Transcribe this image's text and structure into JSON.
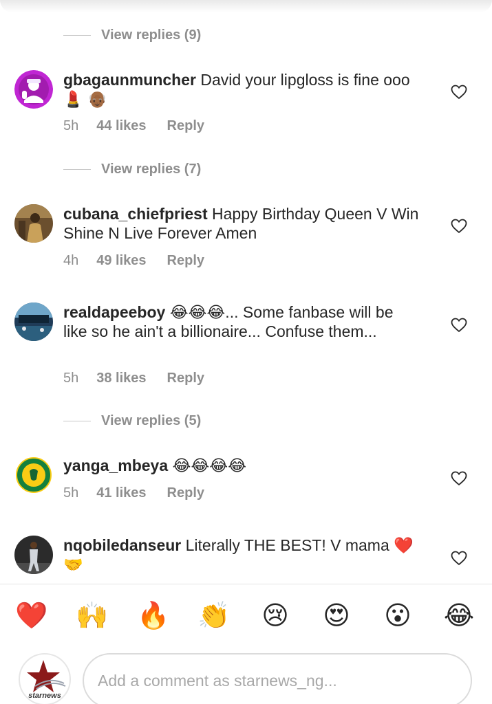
{
  "reply_toggles": [
    {
      "label": "View replies (9)"
    },
    {
      "label": "View replies (7)"
    },
    {
      "label": "View replies (5)"
    }
  ],
  "comments": [
    {
      "username": "gbagaunmuncher",
      "text": "David your lipgloss is fine ooo 💄 👴🏾",
      "time": "5h",
      "likes": "44 likes",
      "reply": "Reply"
    },
    {
      "username": "cubana_chiefpriest",
      "text": "Happy Birthday Queen V Win Shine N Live Forever Amen",
      "time": "4h",
      "likes": "49 likes",
      "reply": "Reply"
    },
    {
      "username": "realdapeeboy",
      "text": "😂😂😂... Some fanbase will be like so he ain't a billionaire... Confuse them...",
      "time": "5h",
      "likes": "38 likes",
      "reply": "Reply"
    },
    {
      "username": "yanga_mbeya",
      "text": "😂😂😂😂",
      "time": "5h",
      "likes": "41 likes",
      "reply": "Reply"
    },
    {
      "username": "nqobiledanseur",
      "text": "Literally THE BEST! V mama ❤️🤝"
    }
  ],
  "reactions": [
    "❤️",
    "🙌",
    "🔥",
    "👏",
    "😢",
    "😍",
    "😮",
    "😂"
  ],
  "composer": {
    "placeholder": "Add a comment as starnews_ng...",
    "avatar_brand": "starnews"
  },
  "colors": {
    "heart_red": "#ed4956",
    "muted_text": "#8e8e8e",
    "brand_red": "#8b1a1a"
  }
}
